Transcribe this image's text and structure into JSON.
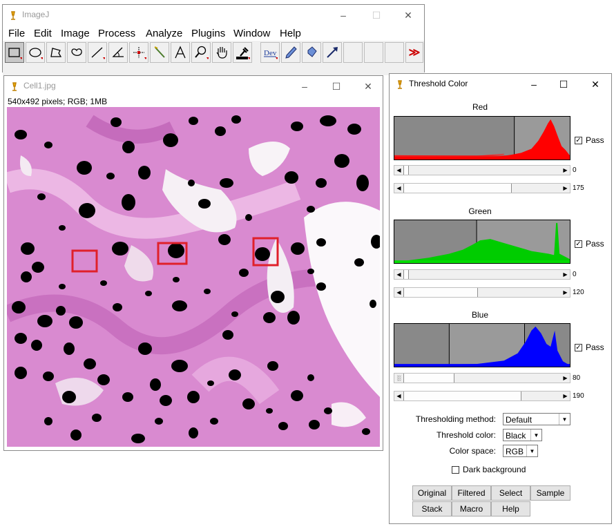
{
  "main": {
    "title": "ImageJ",
    "menus": [
      "File",
      "Edit",
      "Image",
      "Process",
      "Analyze",
      "Plugins",
      "Window",
      "Help"
    ],
    "tools": [
      "rectangle-tool",
      "oval-tool",
      "polygon-tool",
      "freehand-tool",
      "line-tool",
      "angle-tool",
      "point-tool",
      "wand-tool",
      "text-tool",
      "magnifier-tool",
      "hand-tool",
      "color-picker-tool",
      "dev-menu",
      "pencil-tool",
      "flood-fill-tool",
      "arrow-tool",
      "more-tools"
    ],
    "dev_label": "Dev",
    "more_label": "≫"
  },
  "image": {
    "title": "Cell1.jpg",
    "info": "540x492 pixels; RGB; 1MB"
  },
  "threshold": {
    "title": "Threshold Color",
    "channels": [
      {
        "name": "Red",
        "low": "0",
        "high": "175",
        "pass_label": "Pass",
        "color": "#ff0000"
      },
      {
        "name": "Green",
        "low": "0",
        "high": "120",
        "pass_label": "Pass",
        "color": "#00d000"
      },
      {
        "name": "Blue",
        "low": "80",
        "high": "190",
        "pass_label": "Pass",
        "color": "#0000ff"
      }
    ],
    "method_label": "Thresholding method:",
    "method_value": "Default",
    "color_label": "Threshold color:",
    "color_value": "Black",
    "space_label": "Color space:",
    "space_value": "RGB",
    "dark_bg_label": "Dark background",
    "buttons": [
      "Original",
      "Filtered",
      "Select",
      "Sample",
      "Stack",
      "Macro",
      "Help"
    ]
  }
}
